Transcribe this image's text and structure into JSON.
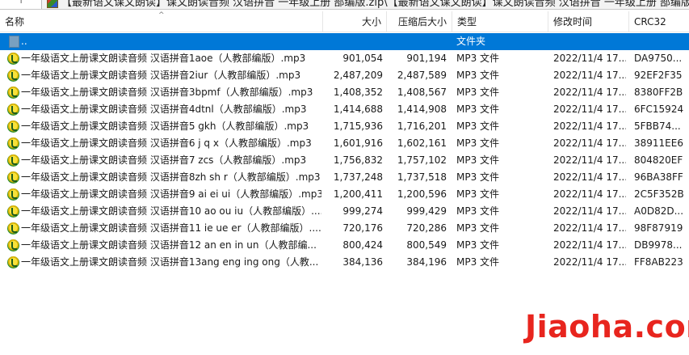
{
  "path": {
    "text": "【最新语文课文朗读】课文朗读音频 汉语拼音 一年级上册 部编版.zip\\【最新语文课文朗读】课文朗读音频 汉语拼音 一年级上册 部编版 - ZIP 压缩"
  },
  "columns": {
    "name": "名称",
    "size": "大小",
    "packed": "压缩后大小",
    "type": "类型",
    "modified": "修改时间",
    "crc": "CRC32"
  },
  "parent_row": {
    "name": "..",
    "type": "文件夹"
  },
  "files": [
    {
      "name": "一年级语文上册课文朗读音频 汉语拼音1aoe（人教部编版）.mp3",
      "size": "901,054",
      "packed": "901,194",
      "type": "MP3 文件",
      "modified": "2022/11/4 17...",
      "crc": "DA9750..."
    },
    {
      "name": "一年级语文上册课文朗读音频 汉语拼音2iur（人教部编版）.mp3",
      "size": "2,487,209",
      "packed": "2,487,589",
      "type": "MP3 文件",
      "modified": "2022/11/4 17...",
      "crc": "92EF2F35"
    },
    {
      "name": "一年级语文上册课文朗读音频 汉语拼音3bpmf（人教部编版）.mp3",
      "size": "1,408,352",
      "packed": "1,408,567",
      "type": "MP3 文件",
      "modified": "2022/11/4 17...",
      "crc": "8380FF2B"
    },
    {
      "name": "一年级语文上册课文朗读音频 汉语拼音4dtnl（人教部编版）.mp3",
      "size": "1,414,688",
      "packed": "1,414,908",
      "type": "MP3 文件",
      "modified": "2022/11/4 17...",
      "crc": "6FC15924"
    },
    {
      "name": "一年级语文上册课文朗读音频 汉语拼音5 gkh（人教部编版）.mp3",
      "size": "1,715,936",
      "packed": "1,716,201",
      "type": "MP3 文件",
      "modified": "2022/11/4 17...",
      "crc": "5FBB74..."
    },
    {
      "name": "一年级语文上册课文朗读音频 汉语拼音6 j q x（人教部编版）.mp3",
      "size": "1,601,916",
      "packed": "1,602,161",
      "type": "MP3 文件",
      "modified": "2022/11/4 17...",
      "crc": "38911EE6"
    },
    {
      "name": "一年级语文上册课文朗读音频 汉语拼音7 zcs（人教部编版）.mp3",
      "size": "1,756,832",
      "packed": "1,757,102",
      "type": "MP3 文件",
      "modified": "2022/11/4 17...",
      "crc": "804820EF"
    },
    {
      "name": "一年级语文上册课文朗读音频 汉语拼音8zh sh r（人教部编版）.mp3",
      "size": "1,737,248",
      "packed": "1,737,518",
      "type": "MP3 文件",
      "modified": "2022/11/4 17...",
      "crc": "96BA38FF"
    },
    {
      "name": "一年级语文上册课文朗读音频 汉语拼音9 ai ei ui（人教部编版）.mp3",
      "size": "1,200,411",
      "packed": "1,200,596",
      "type": "MP3 文件",
      "modified": "2022/11/4 17...",
      "crc": "2C5F352B"
    },
    {
      "name": "一年级语文上册课文朗读音频 汉语拼音10 ao ou iu（人教部编版）....",
      "size": "999,274",
      "packed": "999,429",
      "type": "MP3 文件",
      "modified": "2022/11/4 17...",
      "crc": "A0D82D..."
    },
    {
      "name": "一年级语文上册课文朗读音频 汉语拼音11 ie ue er（人教部编版）....",
      "size": "720,176",
      "packed": "720,286",
      "type": "MP3 文件",
      "modified": "2022/11/4 17...",
      "crc": "98F87919"
    },
    {
      "name": "一年级语文上册课文朗读音频 汉语拼音12 an en in un（人教部编...",
      "size": "800,424",
      "packed": "800,549",
      "type": "MP3 文件",
      "modified": "2022/11/4 17...",
      "crc": "DB9978..."
    },
    {
      "name": "一年级语文上册课文朗读音频 汉语拼音13ang eng ing ong（人教...",
      "size": "384,136",
      "packed": "384,196",
      "type": "MP3 文件",
      "modified": "2022/11/4 17...",
      "crc": "FF8AB223"
    }
  ],
  "watermark": "Jiaoha.com",
  "colors": {
    "selection": "#0078d7",
    "watermark": "#e8251e"
  }
}
